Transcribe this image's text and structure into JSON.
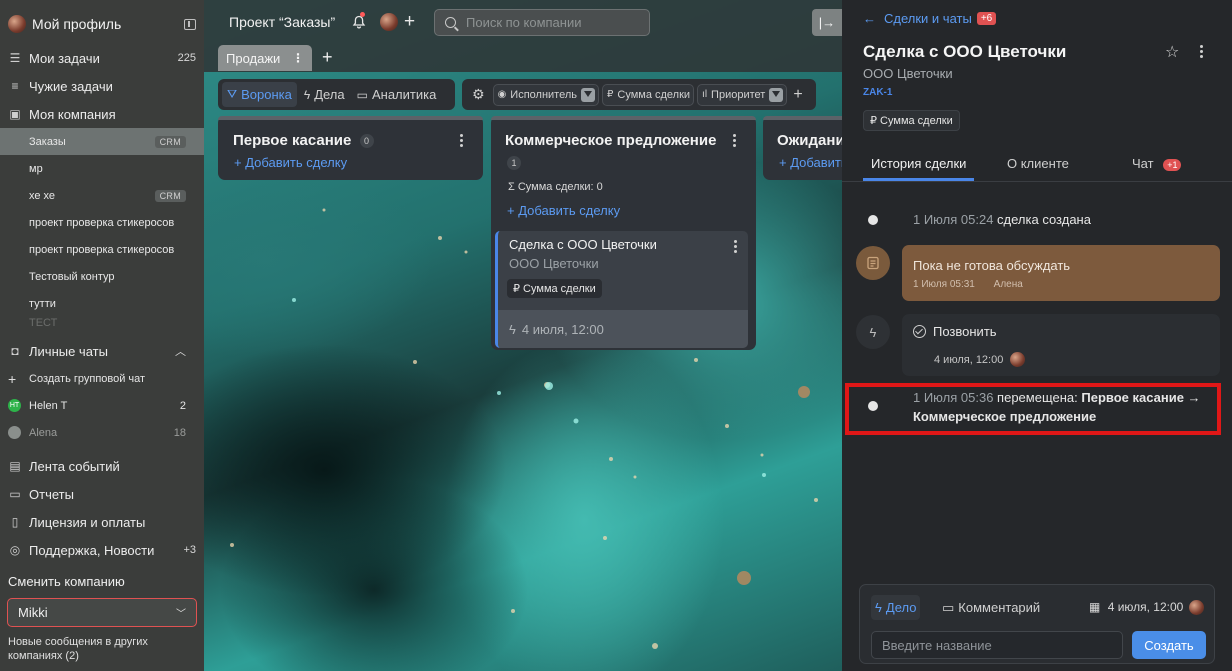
{
  "sidebar": {
    "profile_title": "Мой профиль",
    "nav": [
      {
        "label": "Мои задачи",
        "count": "225",
        "icon": "tasks-list-icon"
      },
      {
        "label": "Чужие задачи",
        "count": "",
        "icon": "list-icon"
      },
      {
        "label": "Моя компания",
        "count": "",
        "icon": "briefcase-icon"
      }
    ],
    "projects": [
      {
        "label": "Заказы",
        "badge": "CRM",
        "active": true
      },
      {
        "label": "мр",
        "badge": ""
      },
      {
        "label": "хе хе",
        "badge": "CRM"
      },
      {
        "label": "проект проверка стикеросов",
        "badge": ""
      },
      {
        "label": "проект проверка стикеросов",
        "badge": ""
      },
      {
        "label": "Тестовый контур",
        "badge": ""
      },
      {
        "label": "тутти",
        "badge": ""
      },
      {
        "label": "ТЕСТ",
        "badge": ""
      }
    ],
    "chats_header": "Личные чаты",
    "create_group_chat": "Создать групповой чат",
    "chats": [
      {
        "name": "Helen T",
        "initials": "HT",
        "count": "2",
        "color": "#2db34a"
      },
      {
        "name": "Alena",
        "initials": "",
        "count": "18",
        "color": "#8a8f8c"
      }
    ],
    "bottom_nav": [
      {
        "label": "Лента событий",
        "icon": "feed-icon",
        "count": ""
      },
      {
        "label": "Отчеты",
        "icon": "reports-icon",
        "count": ""
      },
      {
        "label": "Лицензия и оплаты",
        "icon": "license-icon",
        "count": ""
      },
      {
        "label": "Поддержка, Новости",
        "icon": "support-icon",
        "count": "+3"
      }
    ],
    "switch_company_label": "Сменить компанию",
    "company_selected": "Mikki",
    "footer_note": "Новые сообщения в других компаниях (2)"
  },
  "board": {
    "project_title": "Проект “Заказы”",
    "search_placeholder": "Поиск по компании",
    "tab_label": "Продажи",
    "views": [
      {
        "label": "Воронка",
        "icon": "funnel-icon",
        "active": true
      },
      {
        "label": "Дела",
        "icon": "lightning-icon",
        "active": false
      },
      {
        "label": "Аналитика",
        "icon": "analytics-icon",
        "active": false
      }
    ],
    "filters": [
      {
        "label": "Исполнитель",
        "icon": "user-icon"
      },
      {
        "label": "Сумма сделки",
        "icon": "ruble-icon"
      },
      {
        "label": "Приоритет",
        "icon": "priority-icon"
      }
    ],
    "columns": [
      {
        "title": "Первое касание",
        "count": "0",
        "add_label": "+ Добавить сделку"
      },
      {
        "title": "Коммерческое предложение",
        "count": "1",
        "sum_label": "Σ  Сумма сделки: 0",
        "add_label": "+ Добавить сделку"
      },
      {
        "title": "Ожидание",
        "add_label": "+ Добавить сделку"
      }
    ],
    "card": {
      "title": "Сделка с ООО Цветочки",
      "company": "ООО Цветочки",
      "chip": "₽  Сумма сделки",
      "date": "4 июля, 12:00"
    }
  },
  "panel": {
    "back_label": "Сделки и чаты",
    "back_badge": "+6",
    "title": "Сделка с ООО Цветочки",
    "company": "ООО Цветочки",
    "code": "ZAK-1",
    "chip": "₽  Сумма сделки",
    "tabs": [
      {
        "label": "История сделки",
        "active": true
      },
      {
        "label": "О клиенте",
        "active": false
      },
      {
        "label": "Чат",
        "active": false,
        "badge": "+1"
      }
    ],
    "history": {
      "created_time": "1 Июля 05:24",
      "created_text": "сделка создана",
      "note_text": "Пока не готова обсуждать",
      "note_time": "1 Июля 05:31",
      "note_author": "Алена",
      "task_title": "Позвонить",
      "task_date": "4 июля, 12:00",
      "moved_time": "1 Июля 05:36",
      "moved_label": "перемещена:",
      "moved_stages": "Первое касание → Коммерческое предложение"
    },
    "composer": {
      "tab_task": "Дело",
      "tab_comment": "Комментарий",
      "date": "4 июля, 12:00",
      "input_placeholder": "Введите название",
      "submit_label": "Создать"
    }
  },
  "colors": {
    "accent": "#4a86e8",
    "danger": "#e05252",
    "highlight": "#e01717"
  }
}
